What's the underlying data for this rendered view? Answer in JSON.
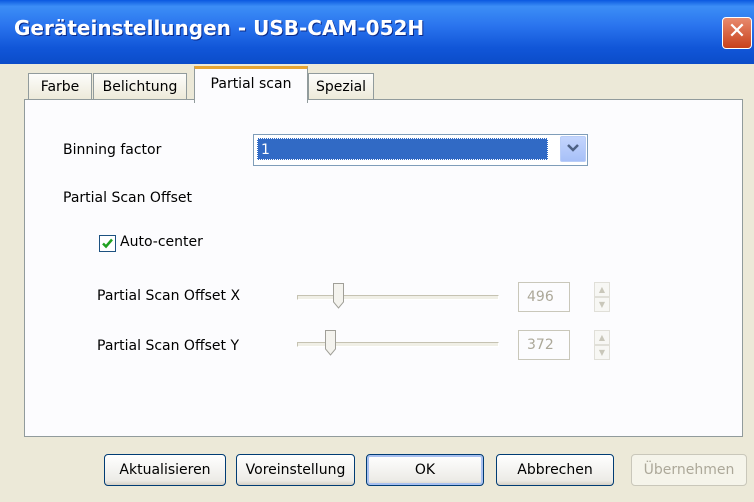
{
  "window": {
    "title": "Geräteinstellungen - USB-CAM-052H",
    "close_label": "✕"
  },
  "tabs": [
    {
      "label": "Farbe",
      "active": false
    },
    {
      "label": "Belichtung",
      "active": false
    },
    {
      "label": "Partial scan",
      "active": true
    },
    {
      "label": "Spezial",
      "active": false
    }
  ],
  "panel": {
    "binning_label": "Binning factor",
    "binning_value": "1",
    "offset_group_label": "Partial Scan Offset",
    "autocenter_label": "Auto-center",
    "autocenter_checked": true,
    "offset_x": {
      "label": "Partial Scan Offset X",
      "value": "496",
      "enabled": false
    },
    "offset_y": {
      "label": "Partial Scan Offset Y",
      "value": "372",
      "enabled": false
    }
  },
  "buttons": {
    "refresh": "Aktualisieren",
    "defaults": "Voreinstellung",
    "ok": "OK",
    "cancel": "Abbrechen",
    "apply": "Übernehmen"
  },
  "colors": {
    "titlebar": "#1156d8",
    "selection": "#316ac5",
    "tab_highlight": "#e6a533",
    "close_button": "#c8411b"
  }
}
